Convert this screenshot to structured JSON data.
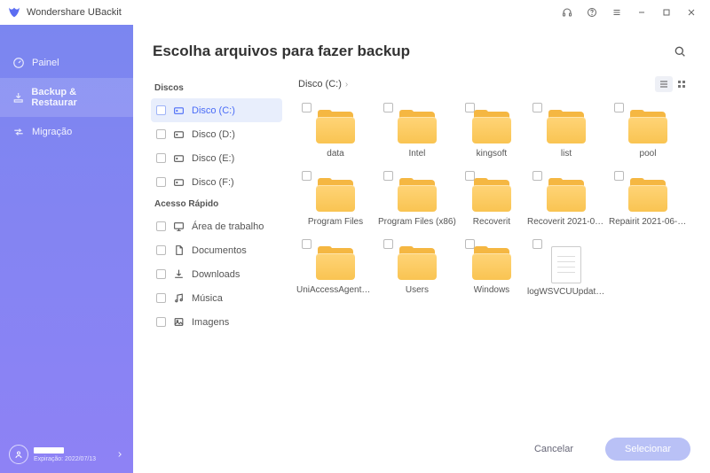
{
  "app": {
    "title": "Wondershare UBackit"
  },
  "nav": {
    "items": [
      {
        "label": "Painel"
      },
      {
        "label": "Backup & Restaurar"
      },
      {
        "label": "Migração"
      }
    ]
  },
  "user": {
    "expires_prefix": "Expiração:",
    "expires_date": "2022/07/13"
  },
  "page": {
    "title": "Escolha arquivos para fazer backup"
  },
  "mid": {
    "disks_label": "Discos",
    "qa_label": "Acesso Rápido",
    "disks": [
      {
        "label": "Disco (C:)"
      },
      {
        "label": "Disco (D:)"
      },
      {
        "label": "Disco (E:)"
      },
      {
        "label": "Disco (F:)"
      }
    ],
    "qa": [
      {
        "label": "Área de trabalho"
      },
      {
        "label": "Documentos"
      },
      {
        "label": "Downloads"
      },
      {
        "label": "Música"
      },
      {
        "label": "Imagens"
      }
    ]
  },
  "crumbs": {
    "current": "Disco (C:)"
  },
  "files": [
    {
      "name": "data",
      "type": "folder"
    },
    {
      "name": "Intel",
      "type": "folder"
    },
    {
      "name": "kingsoft",
      "type": "folder"
    },
    {
      "name": "list",
      "type": "folder"
    },
    {
      "name": "pool",
      "type": "folder"
    },
    {
      "name": "Program Files",
      "type": "folder"
    },
    {
      "name": "Program Files (x86)",
      "type": "folder"
    },
    {
      "name": "Recoverit",
      "type": "folder"
    },
    {
      "name": "Recoverit 2021-06-...",
      "type": "folder"
    },
    {
      "name": "Repairit 2021-06-1...",
      "type": "folder"
    },
    {
      "name": "UniAccessAgentD...",
      "type": "folder"
    },
    {
      "name": "Users",
      "type": "folder"
    },
    {
      "name": "Windows",
      "type": "folder"
    },
    {
      "name": "logWSVCUUpdate...",
      "type": "file"
    }
  ],
  "footer": {
    "cancel": "Cancelar",
    "select": "Selecionar"
  }
}
